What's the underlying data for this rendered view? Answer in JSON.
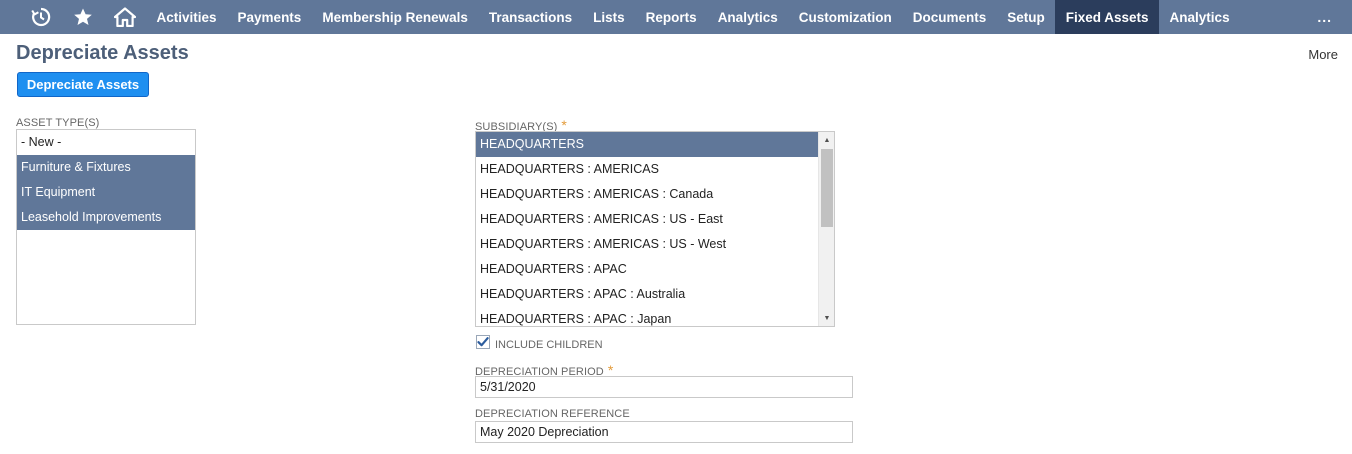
{
  "nav": {
    "icons": [
      "recent-icon",
      "star-icon",
      "home-icon"
    ],
    "items": [
      {
        "label": "Activities"
      },
      {
        "label": "Payments"
      },
      {
        "label": "Membership Renewals"
      },
      {
        "label": "Transactions"
      },
      {
        "label": "Lists"
      },
      {
        "label": "Reports"
      },
      {
        "label": "Analytics"
      },
      {
        "label": "Customization"
      },
      {
        "label": "Documents"
      },
      {
        "label": "Setup"
      },
      {
        "label": "Fixed Assets",
        "active": true
      },
      {
        "label": "Analytics"
      }
    ],
    "more": "..."
  },
  "page": {
    "title": "Depreciate Assets",
    "more_link": "More",
    "primary_button": "Depreciate Assets"
  },
  "asset_types": {
    "label": "ASSET TYPE(S)",
    "options": [
      {
        "label": "- New -",
        "selected": false
      },
      {
        "label": "Furniture & Fixtures",
        "selected": true
      },
      {
        "label": "IT Equipment",
        "selected": true
      },
      {
        "label": "Leasehold Improvements",
        "selected": true
      }
    ]
  },
  "subsidiaries": {
    "label": "SUBSIDIARY(S)",
    "required_mark": "*",
    "options": [
      {
        "label": "HEADQUARTERS",
        "selected": true
      },
      {
        "label": "HEADQUARTERS : AMERICAS",
        "selected": false
      },
      {
        "label": "HEADQUARTERS : AMERICAS : Canada",
        "selected": false
      },
      {
        "label": "HEADQUARTERS : AMERICAS : US - East",
        "selected": false
      },
      {
        "label": "HEADQUARTERS : AMERICAS : US - West",
        "selected": false
      },
      {
        "label": "HEADQUARTERS : APAC",
        "selected": false
      },
      {
        "label": "HEADQUARTERS : APAC : Australia",
        "selected": false
      },
      {
        "label": "HEADQUARTERS : APAC : Japan",
        "selected": false
      }
    ]
  },
  "include_children": {
    "label": "INCLUDE CHILDREN",
    "checked": true
  },
  "depreciation_period": {
    "label": "DEPRECIATION PERIOD",
    "required_mark": "*",
    "value": "5/31/2020"
  },
  "depreciation_reference": {
    "label": "DEPRECIATION REFERENCE",
    "value": "May 2020 Depreciation"
  },
  "colors": {
    "nav_bg": "#607799",
    "nav_active": "#2b3d5c",
    "primary_button": "#1f8ff0",
    "selected_row": "#607799",
    "required": "#e39b3a"
  }
}
